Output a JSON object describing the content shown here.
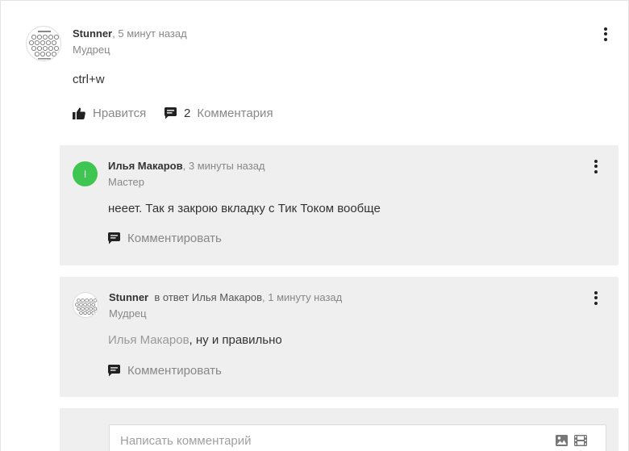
{
  "thread": {
    "root": {
      "author": "Stunner",
      "time": ", 5 минут назад",
      "rank": "Мудрец",
      "text": "ctrl+w",
      "like_label": "Нравится",
      "comments_count": "2",
      "comments_label": "Комментария"
    },
    "replies": [
      {
        "author": "Илья Макаров",
        "avatar_letter": "I",
        "avatar_color": "#3fc552",
        "time": ", 3 минуты назад",
        "rank": "Мастер",
        "text": "нееет. Так я закрою вкладку с Тик Током вообще",
        "comment_label": "Комментировать"
      },
      {
        "author": "Stunner",
        "reply_prefix": "в ответ Илья Макаров",
        "time": ", 1 минуту назад",
        "rank": "Мудрец",
        "mention": "Илья Макаров",
        "text": ", ну и правильно",
        "comment_label": "Комментировать"
      }
    ]
  },
  "composer": {
    "placeholder": "Написать комментарий"
  },
  "icons": {
    "like": "thumbs-up-icon",
    "comments": "speech-bubble-icon",
    "more": "kebab-menu-icon",
    "image": "image-icon",
    "video": "film-icon"
  },
  "colors": {
    "reply_background": "#efefef",
    "accent_green": "#3fc552"
  }
}
